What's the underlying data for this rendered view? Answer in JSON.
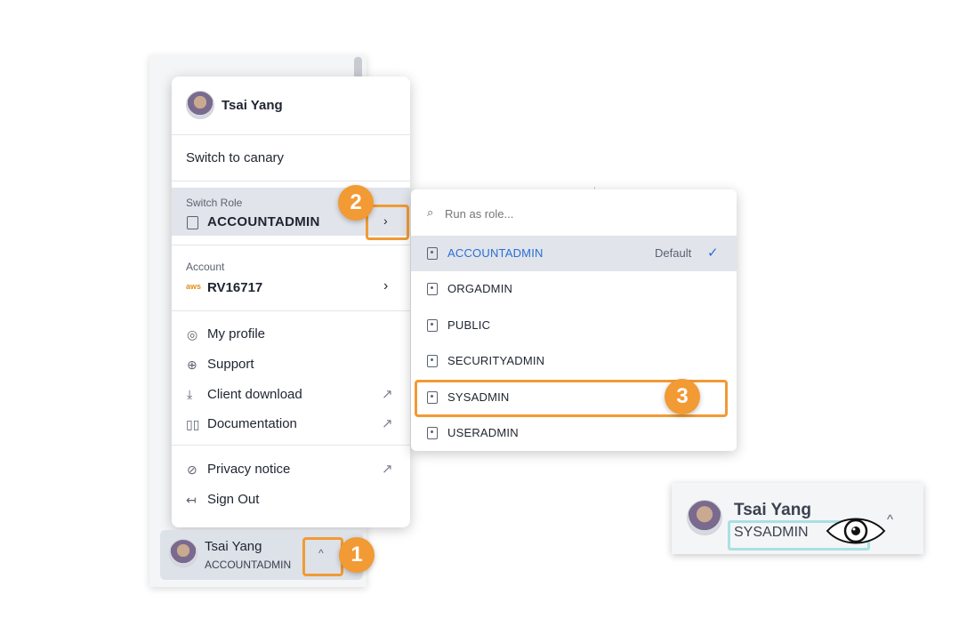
{
  "menu": {
    "user_name": "Tsai Yang",
    "switch_canary": "Switch to canary",
    "switch_role_label": "Switch Role",
    "current_role": "ACCOUNTADMIN",
    "account_label": "Account",
    "account_provider": "aws",
    "account_id": "RV16717",
    "items": [
      {
        "label": "My profile",
        "icon": "person-circle-icon"
      },
      {
        "label": "Support",
        "icon": "lifebuoy-icon"
      },
      {
        "label": "Client download",
        "icon": "download-icon",
        "external": true
      },
      {
        "label": "Documentation",
        "icon": "book-icon",
        "external": true
      },
      {
        "label": "Privacy notice",
        "icon": "eye-slash-icon",
        "external": true
      },
      {
        "label": "Sign Out",
        "icon": "sign-out-icon"
      }
    ]
  },
  "user_button": {
    "name": "Tsai Yang",
    "role": "ACCOUNTADMIN"
  },
  "submenu": {
    "search_placeholder": "Run as role...",
    "default_label": "Default",
    "roles": [
      "ACCOUNTADMIN",
      "ORGADMIN",
      "PUBLIC",
      "SECURITYADMIN",
      "SYSADMIN",
      "USERADMIN"
    ],
    "selected_role": "ACCOUNTADMIN"
  },
  "badges": [
    "1",
    "2",
    "3"
  ],
  "result": {
    "name": "Tsai Yang",
    "role": "SYSADMIN"
  },
  "colors": {
    "accent_orange": "#f29a34",
    "selected_blue": "#2a6fd6",
    "teal_highlight": "#a9e0e3"
  }
}
